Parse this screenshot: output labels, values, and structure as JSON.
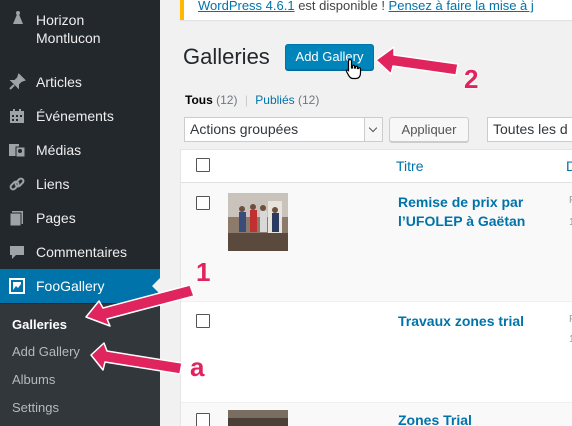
{
  "site": {
    "name": "Horizon Montlucon"
  },
  "menu": [
    {
      "label": "Articles",
      "icon": "pin-icon"
    },
    {
      "label": "Événements",
      "icon": "calendar-icon"
    },
    {
      "label": "Médias",
      "icon": "media-icon"
    },
    {
      "label": "Liens",
      "icon": "link-icon"
    },
    {
      "label": "Pages",
      "icon": "pages-icon"
    },
    {
      "label": "Commentaires",
      "icon": "comment-icon"
    },
    {
      "label": "FooGallery",
      "icon": "gallery-icon"
    }
  ],
  "submenu": [
    "Galleries",
    "Add Gallery",
    "Albums",
    "Settings"
  ],
  "notice": {
    "prefix": "WordPress 4.6.1",
    "middle": " est disponible ! ",
    "link": "Pensez à faire la mise à j"
  },
  "page": {
    "title": "Galleries",
    "add_button": "Add Gallery"
  },
  "filters": {
    "all_label": "Tous",
    "all_count": "(12)",
    "separator": "|",
    "published_label": "Publiés",
    "published_count": "(12)"
  },
  "bulk": {
    "selected": "Actions groupées",
    "apply": "Appliquer",
    "dates": "Toutes les d"
  },
  "table": {
    "col_title": "Titre",
    "col_date": "D",
    "rows": [
      {
        "title": "Remise de prix par l’UFOLEP à Gaëtan",
        "edge_top": "P",
        "edge_bottom": "1"
      },
      {
        "title": "Travaux zones trial",
        "edge_top": "P",
        "edge_bottom": "1"
      },
      {
        "title": "Zones Trial",
        "edge_top": "",
        "edge_bottom": ""
      }
    ]
  },
  "annotations": {
    "n1": "1",
    "n2": "2",
    "na": "a"
  },
  "colors": {
    "sidebar": "#23282d",
    "active": "#0073aa",
    "submenu": "#32373c",
    "accent": "#0085ba",
    "arrow": "#e0245e"
  }
}
